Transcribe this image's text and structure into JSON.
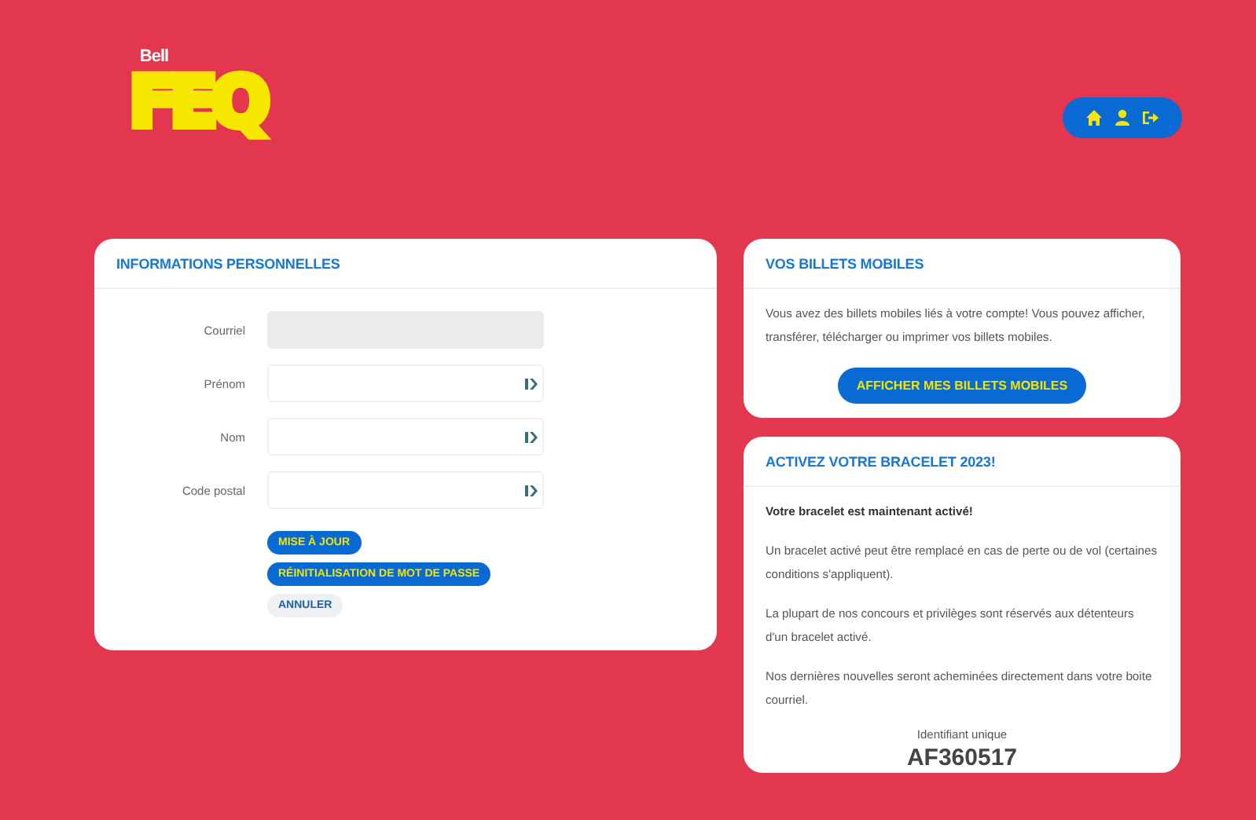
{
  "logo": {
    "brand": "Bell",
    "title": "FEQ"
  },
  "nav": [
    {
      "kind": "home"
    },
    {
      "kind": "user"
    },
    {
      "kind": "logout"
    }
  ],
  "profile": {
    "title": "INFORMATIONS PERSONNELLES",
    "fields": [
      {
        "label": "Courriel",
        "disabled": true
      },
      {
        "label": "Prénom",
        "disabled": false
      },
      {
        "label": "Nom",
        "disabled": false
      },
      {
        "label": "Code postal",
        "disabled": false
      }
    ],
    "buttons": [
      {
        "label": "MISE À JOUR",
        "kind": "primary"
      },
      {
        "label": "RÉINITIALISATION DE MOT DE PASSE",
        "kind": "primary"
      },
      {
        "label": "ANNULER",
        "kind": "secondary"
      }
    ]
  },
  "tickets": {
    "title": "VOS BILLETS MOBILES",
    "text": "Vous avez des billets mobiles liés à votre compte! Vous pouvez afficher, transférer, télécharger ou imprimer vos billets mobiles.",
    "button": "AFFICHER MES BILLETS MOBILES"
  },
  "bracelet": {
    "title": "ACTIVEZ VOTRE BRACELET 2023!",
    "status": "Votre bracelet est maintenant activé!",
    "paragraphs": [
      "Un bracelet activé peut être remplacé en cas de perte ou de vol (certaines conditions s'appliquent).",
      "La plupart de nos concours et privilèges sont réservés aux détenteurs d'un bracelet activé.",
      "Nos dernières nouvelles seront acheminées directement dans votre boite courriel."
    ],
    "id_label": "Identifiant unique",
    "id_value": "AF360517"
  }
}
